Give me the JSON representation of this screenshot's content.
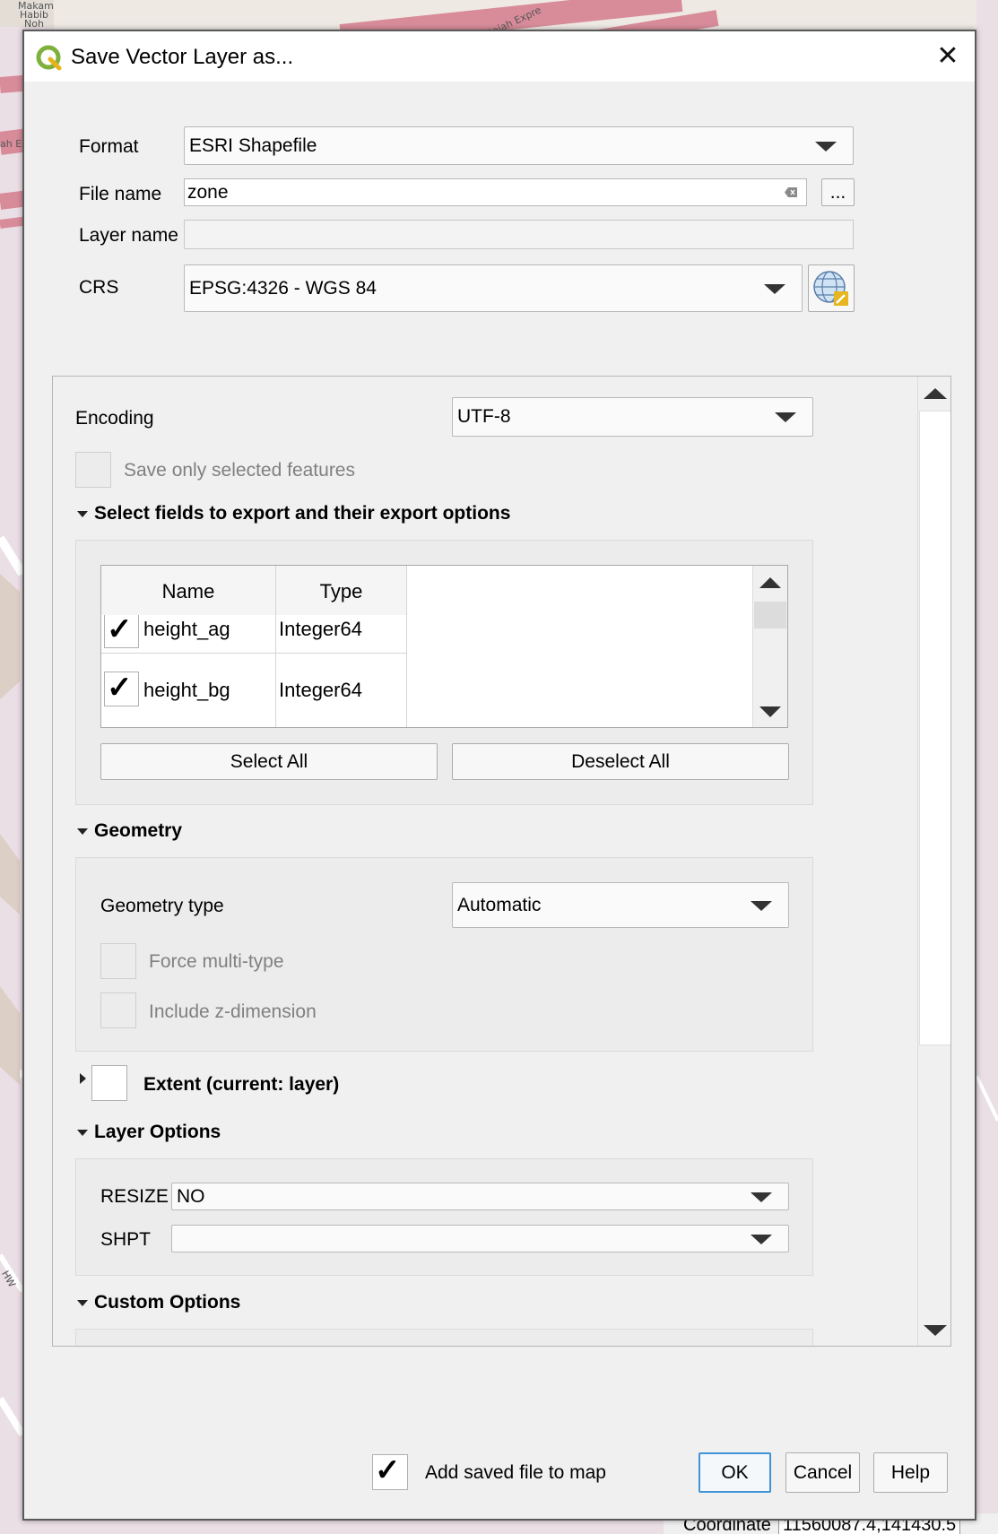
{
  "map": {
    "labels": [
      "Makam",
      "Habib",
      "Noh",
      "ah Ex",
      "Rajah Expre",
      "HW"
    ]
  },
  "status_bar": {
    "coordinate_label": "Coordinate",
    "coordinate_value": "11560087.4,141430.5"
  },
  "dialog": {
    "title": "Save Vector Layer as...",
    "format": {
      "label": "Format",
      "value": "ESRI Shapefile"
    },
    "file_name": {
      "label": "File name",
      "value": "zone",
      "browse_label": "..."
    },
    "layer_name": {
      "label": "Layer name",
      "value": ""
    },
    "crs": {
      "label": "CRS",
      "value": "EPSG:4326 - WGS 84"
    },
    "encoding": {
      "label": "Encoding",
      "value": "UTF-8"
    },
    "save_only_selected": {
      "label": "Save only selected features",
      "checked": false,
      "enabled": false
    },
    "fields_section": {
      "title": "Select fields to export and their export options",
      "columns": [
        "Name",
        "Type"
      ],
      "rows": [
        {
          "checked": true,
          "name": "height_ag",
          "type": "Integer64"
        },
        {
          "checked": true,
          "name": "height_bg",
          "type": "Integer64"
        }
      ],
      "select_all_label": "Select All",
      "deselect_all_label": "Deselect All"
    },
    "geometry_section": {
      "title": "Geometry",
      "geometry_type_label": "Geometry type",
      "geometry_type_value": "Automatic",
      "force_multi_label": "Force multi-type",
      "include_z_label": "Include z-dimension"
    },
    "extent_section": {
      "title": "Extent (current: layer)",
      "checked": false
    },
    "layer_options_section": {
      "title": "Layer Options",
      "options": [
        {
          "name": "RESIZE",
          "value": "NO"
        },
        {
          "name": "SHPT",
          "value": ""
        }
      ]
    },
    "custom_options_section": {
      "title": "Custom Options"
    },
    "add_to_map": {
      "label": "Add saved file to map",
      "checked": true
    },
    "buttons": {
      "ok": "OK",
      "cancel": "Cancel",
      "help": "Help"
    },
    "tick_glyph": "✓",
    "close_glyph": "✕"
  }
}
